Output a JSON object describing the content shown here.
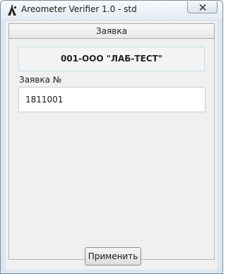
{
  "window": {
    "title": "Areometer Verifier 1.0 - std"
  },
  "tab": {
    "label": "Заявка"
  },
  "organization": {
    "name": "001-ООО \"ЛАБ-ТЕСТ\""
  },
  "request": {
    "label": "Заявка №",
    "value": "1811001"
  },
  "actions": {
    "apply_label": "Применить"
  },
  "icons": {
    "app": "areometer-app-icon",
    "close": "close-icon"
  }
}
